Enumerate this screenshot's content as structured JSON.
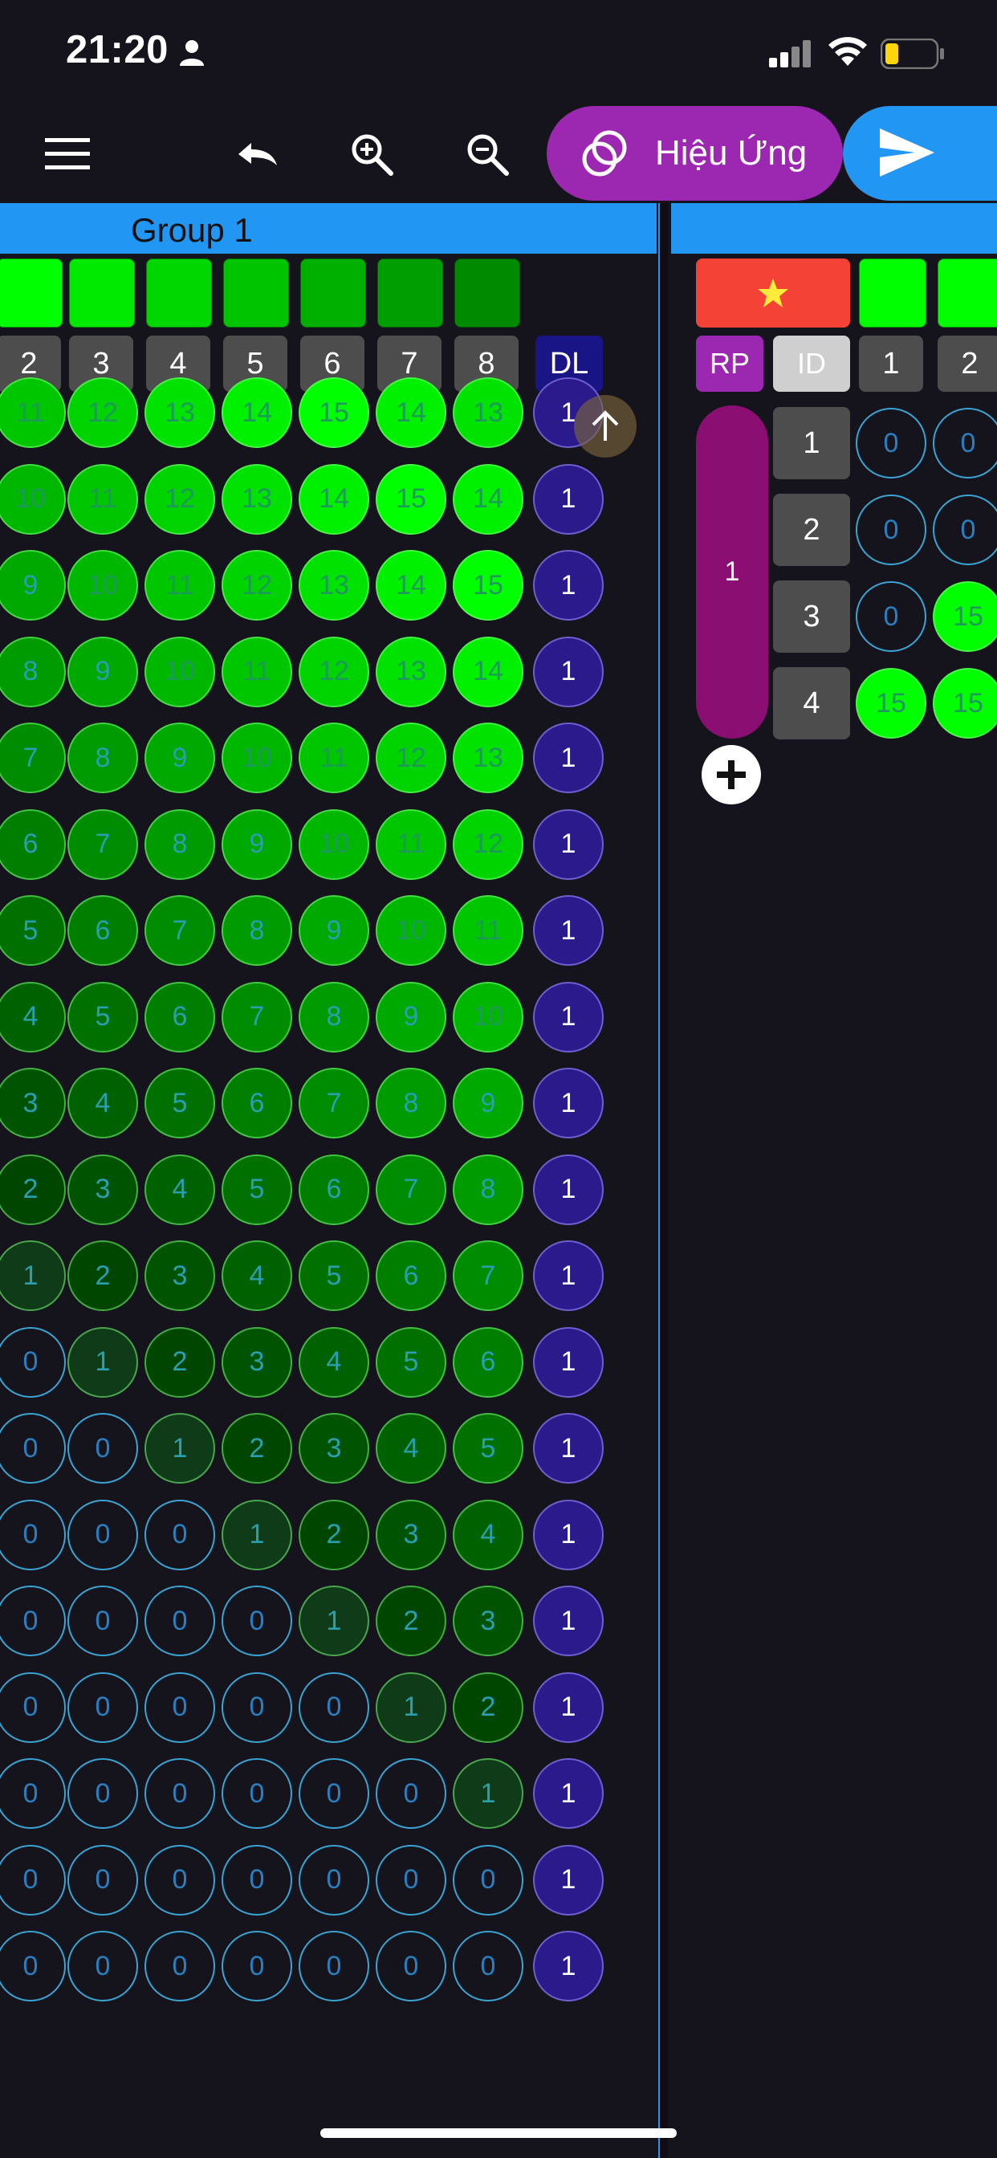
{
  "status_bar": {
    "time": "21:20"
  },
  "toolbar": {
    "menu_icon": "menu-icon",
    "undo_icon": "undo-icon",
    "zoom_in_icon": "zoom-in-icon",
    "zoom_out_icon": "zoom-out-icon",
    "effects_label": "Hiệu Ứng",
    "send_icon": "send-icon"
  },
  "group1": {
    "title": "Group 1",
    "swatch_colors": [
      "#00ff00",
      "#00ea00",
      "#00d600",
      "#00c400",
      "#00b000",
      "#009e00",
      "#008a00"
    ],
    "column_headers": [
      "2",
      "3",
      "4",
      "5",
      "6",
      "7",
      "8"
    ],
    "dl_label": "DL",
    "rows": [
      {
        "values": [
          "11",
          "12",
          "13",
          "14",
          "15",
          "14",
          "13"
        ],
        "dl": "1"
      },
      {
        "values": [
          "10",
          "11",
          "12",
          "13",
          "14",
          "15",
          "14"
        ],
        "dl": "1"
      },
      {
        "values": [
          "9",
          "10",
          "11",
          "12",
          "13",
          "14",
          "15"
        ],
        "dl": "1"
      },
      {
        "values": [
          "8",
          "9",
          "10",
          "11",
          "12",
          "13",
          "14"
        ],
        "dl": "1"
      },
      {
        "values": [
          "7",
          "8",
          "9",
          "10",
          "11",
          "12",
          "13"
        ],
        "dl": "1"
      },
      {
        "values": [
          "6",
          "7",
          "8",
          "9",
          "10",
          "11",
          "12"
        ],
        "dl": "1"
      },
      {
        "values": [
          "5",
          "6",
          "7",
          "8",
          "9",
          "10",
          "11"
        ],
        "dl": "1"
      },
      {
        "values": [
          "4",
          "5",
          "6",
          "7",
          "8",
          "9",
          "10"
        ],
        "dl": "1"
      },
      {
        "values": [
          "3",
          "4",
          "5",
          "6",
          "7",
          "8",
          "9"
        ],
        "dl": "1"
      },
      {
        "values": [
          "2",
          "3",
          "4",
          "5",
          "6",
          "7",
          "8"
        ],
        "dl": "1"
      },
      {
        "values": [
          "1",
          "2",
          "3",
          "4",
          "5",
          "6",
          "7"
        ],
        "dl": "1"
      },
      {
        "values": [
          "0",
          "1",
          "2",
          "3",
          "4",
          "5",
          "6"
        ],
        "dl": "1"
      },
      {
        "values": [
          "0",
          "0",
          "1",
          "2",
          "3",
          "4",
          "5"
        ],
        "dl": "1"
      },
      {
        "values": [
          "0",
          "0",
          "0",
          "1",
          "2",
          "3",
          "4"
        ],
        "dl": "1"
      },
      {
        "values": [
          "0",
          "0",
          "0",
          "0",
          "1",
          "2",
          "3"
        ],
        "dl": "1"
      },
      {
        "values": [
          "0",
          "0",
          "0",
          "0",
          "0",
          "1",
          "2"
        ],
        "dl": "1"
      },
      {
        "values": [
          "0",
          "0",
          "0",
          "0",
          "0",
          "0",
          "1"
        ],
        "dl": "1"
      },
      {
        "values": [
          "0",
          "0",
          "0",
          "0",
          "0",
          "0",
          "0"
        ],
        "dl": "1"
      },
      {
        "values": [
          "0",
          "0",
          "0",
          "0",
          "0",
          "0",
          "0"
        ],
        "dl": "1"
      }
    ]
  },
  "group2": {
    "flag_icon": "vietnam-flag-icon",
    "rp_label": "RP",
    "id_label": "ID",
    "column_headers": [
      "1",
      "2"
    ],
    "pill_label": "1",
    "row_ids": [
      "1",
      "2",
      "3",
      "4"
    ],
    "rows": [
      [
        "0",
        "0"
      ],
      [
        "0",
        "0"
      ],
      [
        "0",
        "15"
      ],
      [
        "15",
        "15"
      ]
    ],
    "add_icon": "plus-icon"
  },
  "scroll_top_icon": "arrow-up-icon"
}
